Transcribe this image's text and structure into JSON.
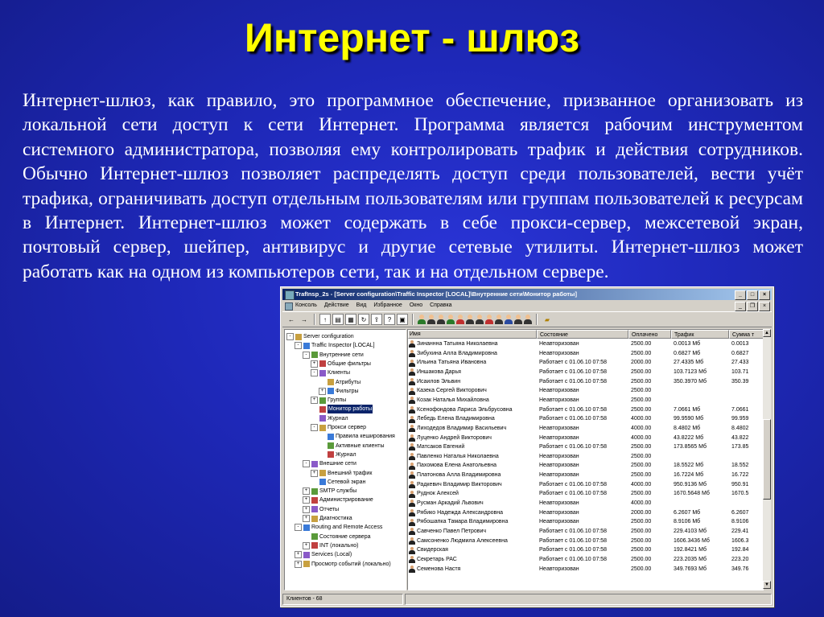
{
  "slide": {
    "title": "Интернет - шлюз",
    "body": "Интернет-шлюз, как правило, это программное обеспечение, призванное организовать из локальной сети доступ к сети Интернет. Программа является рабочим инструментом системного администратора, позволяя ему контролировать трафик и действия сотрудников. Обычно Интернет-шлюз позволяет распределять доступ среди пользователей, вести учёт трафика, ограничивать доступ отдельным пользователям или группам пользователей к ресурсам в Интернет. Интернет-шлюз может содержать в себе прокси-сервер, межсетевой экран, почтовый сервер, шейпер, антивирус и другие сетевые утилиты. Интернет-шлюз может работать как на одном из компьютеров сети, так и на отдельном сервере."
  },
  "window": {
    "title": "TrafInsp_2s - [Server configuration\\Traffic Inspector [LOCAL]\\Внутренние сети\\Монитор работы]",
    "menu": [
      "Консоль",
      "Действие",
      "Вид",
      "Избранное",
      "Окно",
      "Справка"
    ],
    "tree": [
      {
        "label": "Server configuration",
        "indent": 0,
        "exp": "-"
      },
      {
        "label": "Traffic Inspector [LOCAL]",
        "indent": 1,
        "exp": "-"
      },
      {
        "label": "Внутренние сети",
        "indent": 2,
        "exp": "-"
      },
      {
        "label": "Общие фильтры",
        "indent": 3,
        "exp": "+"
      },
      {
        "label": "Клиенты",
        "indent": 3,
        "exp": "-"
      },
      {
        "label": "Атрибуты",
        "indent": 4,
        "exp": ""
      },
      {
        "label": "Фильтры",
        "indent": 4,
        "exp": "+"
      },
      {
        "label": "Группы",
        "indent": 3,
        "exp": "+"
      },
      {
        "label": "Монитор работы",
        "indent": 3,
        "exp": "",
        "selected": true
      },
      {
        "label": "Журнал",
        "indent": 3,
        "exp": ""
      },
      {
        "label": "Прокси сервер",
        "indent": 3,
        "exp": "-"
      },
      {
        "label": "Правила кеширования",
        "indent": 4,
        "exp": ""
      },
      {
        "label": "Активные клиенты",
        "indent": 4,
        "exp": ""
      },
      {
        "label": "Журнал",
        "indent": 4,
        "exp": ""
      },
      {
        "label": "Внешние сети",
        "indent": 2,
        "exp": "-"
      },
      {
        "label": "Внешний трафик",
        "indent": 3,
        "exp": "+"
      },
      {
        "label": "Сетевой экран",
        "indent": 3,
        "exp": ""
      },
      {
        "label": "SMTP службы",
        "indent": 2,
        "exp": "+"
      },
      {
        "label": "Администрирование",
        "indent": 2,
        "exp": "+"
      },
      {
        "label": "Отчеты",
        "indent": 2,
        "exp": "+"
      },
      {
        "label": "Диагностика",
        "indent": 2,
        "exp": "+"
      },
      {
        "label": "Routing and Remote Access",
        "indent": 1,
        "exp": "-"
      },
      {
        "label": "Состояние сервера",
        "indent": 2,
        "exp": ""
      },
      {
        "label": "INT (локально)",
        "indent": 2,
        "exp": "+"
      },
      {
        "label": "Services (Local)",
        "indent": 1,
        "exp": "+"
      },
      {
        "label": "Просмотр событий (локально)",
        "indent": 1,
        "exp": "+"
      }
    ],
    "columns": [
      "Имя",
      "Состояние",
      "Оплачено",
      "Трафик",
      "Сумма т"
    ],
    "rows": [
      [
        "Зинаннна Татьяна Николаевна",
        "Неавторизован",
        "2500.00",
        "0.0013 Мб",
        "0.0013"
      ],
      [
        "Зибухина Алла Владимировна",
        "Неавторизован",
        "2500.00",
        "0.6827 Мб",
        "0.6827"
      ],
      [
        "Ильина Татьяна Ивановна",
        "Работает с 01.06.10 07:58",
        "2000.00",
        "27.4335 Мб",
        "27.433"
      ],
      [
        "Иншакова Дарья",
        "Работает с 01.06.10 07:58",
        "2500.00",
        "103.7123 Мб",
        "103.71"
      ],
      [
        "Исаилов Эльвин",
        "Работает с 01.06.10 07:58",
        "2500.00",
        "350.3970 Мб",
        "350.39"
      ],
      [
        "Казека Сергей Викторович",
        "Неавторизован",
        "2500.00",
        "",
        ""
      ],
      [
        "Козак Наталья Михайловна",
        "Неавторизован",
        "2500.00",
        "",
        ""
      ],
      [
        "Ксенофондова Лариса Эльбрусовна",
        "Работает с 01.06.10 07:58",
        "2500.00",
        "7.0661 Мб",
        "7.0661"
      ],
      [
        "Лебедь Елена Владимировна",
        "Работает с 01.06.10 07:58",
        "4000.00",
        "99.9590 Мб",
        "99.959"
      ],
      [
        "Лиходедов Владимир Васильевич",
        "Неавторизован",
        "4000.00",
        "8.4802 Мб",
        "8.4802"
      ],
      [
        "Луценко Андрей Викторович",
        "Неавторизован",
        "4000.00",
        "43.8222 Мб",
        "43.822"
      ],
      [
        "Матсаков Евгений",
        "Работает с 01.06.10 07:58",
        "2500.00",
        "173.8565 Мб",
        "173.85"
      ],
      [
        "Павленко Наталья Николаевна",
        "Неавторизован",
        "2500.00",
        "",
        ""
      ],
      [
        "Пахомова Елена Анатольевна",
        "Неавторизован",
        "2500.00",
        "18.5522 Мб",
        "18.552"
      ],
      [
        "Платонова Алла Владимировна",
        "Неавторизован",
        "2500.00",
        "16.7224 Мб",
        "16.722"
      ],
      [
        "Радкевич Владимир Викторович",
        "Работает с 01.06.10 07:58",
        "4000.00",
        "950.9136 Мб",
        "950.91"
      ],
      [
        "Руднок Алексей",
        "Работает с 01.06.10 07:58",
        "2500.00",
        "1670.5648 Мб",
        "1670.5"
      ],
      [
        "Русман Аркадий Львович",
        "Неавторизован",
        "4000.00",
        "",
        ""
      ],
      [
        "Рябико Надежда Александровна",
        "Неавторизован",
        "2000.00",
        "6.2607 Мб",
        "6.2607"
      ],
      [
        "Рябошапка Тамара Владимировна",
        "Неавторизован",
        "2500.00",
        "8.9106 Мб",
        "8.9106"
      ],
      [
        "Савченко Павел Петрович",
        "Работает с 01.06.10 07:58",
        "2500.00",
        "229.4103 Мб",
        "229.41"
      ],
      [
        "Самсоненко Людмила Алексеевна",
        "Работает с 01.06.10 07:58",
        "2500.00",
        "1606.3436 Мб",
        "1606.3"
      ],
      [
        "Свидерская",
        "Работает с 01.06.10 07:58",
        "2500.00",
        "192.8421 Мб",
        "192.84"
      ],
      [
        "Секретарь РАС",
        "Работает с 01.06.10 07:58",
        "2500.00",
        "223.2035 Мб",
        "223.20"
      ],
      [
        "Семенова Настя",
        "Неавторизован",
        "2500.00",
        "349.7693 Мб",
        "349.76"
      ]
    ],
    "status": "Клиентов - 68"
  }
}
